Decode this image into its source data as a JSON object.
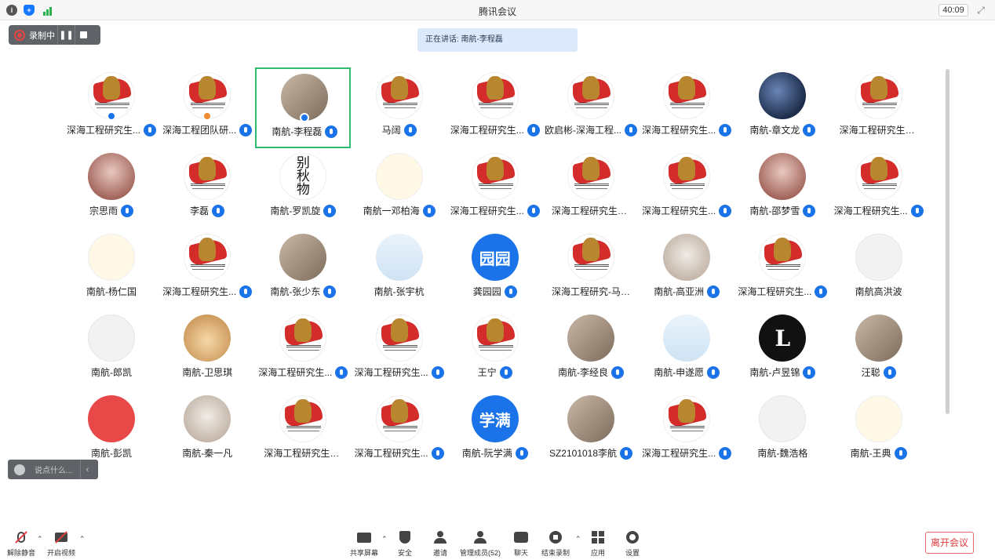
{
  "window": {
    "title": "腾讯会议",
    "timer": "40:09"
  },
  "recording": {
    "label": "录制中"
  },
  "speaking": {
    "text": "正在讲话: 南航-李程磊"
  },
  "participants": [
    {
      "name": "深海工程研究生...",
      "avatar": "logo",
      "badge": "blue"
    },
    {
      "name": "深海工程团队研...",
      "avatar": "logo",
      "badge": "orange"
    },
    {
      "name": "南航-李程磊",
      "avatar": "photo",
      "badge": "blue",
      "active": true
    },
    {
      "name": "马阔",
      "avatar": "logo"
    },
    {
      "name": "深海工程研究生...",
      "avatar": "logo"
    },
    {
      "name": "欧启彬-深海工程...",
      "avatar": "logo"
    },
    {
      "name": "深海工程研究生...",
      "avatar": "logo"
    },
    {
      "name": "南航-章文龙",
      "avatar": "dark"
    },
    {
      "name": "深海工程研究生党支...",
      "avatar": "logo",
      "no_mic": true
    },
    {
      "name": "宗思雨",
      "avatar": "rose"
    },
    {
      "name": "李磊",
      "avatar": "logo"
    },
    {
      "name": "南航-罗凯旋",
      "avatar": "calligraphy",
      "avatar_text": "别\n秋\n物"
    },
    {
      "name": "南航一邓柏海",
      "avatar": "cartoon"
    },
    {
      "name": "深海工程研究生...",
      "avatar": "logo"
    },
    {
      "name": "深海工程研究生党支...",
      "avatar": "logo",
      "no_mic": true
    },
    {
      "name": "深海工程研究生...",
      "avatar": "logo"
    },
    {
      "name": "南航-邵梦雪",
      "avatar": "rose"
    },
    {
      "name": "深海工程研究生...",
      "avatar": "logo"
    },
    {
      "name": "南航-杨仁国",
      "avatar": "cartoon",
      "no_mic": true
    },
    {
      "name": "深海工程研究生...",
      "avatar": "logo"
    },
    {
      "name": "南航-张少东",
      "avatar": "photo"
    },
    {
      "name": "南航-张宇杭",
      "avatar": "sky",
      "no_mic": true
    },
    {
      "name": "龚园园",
      "avatar": "text",
      "avatar_text": "园园"
    },
    {
      "name": "深海工程研究-马明雨",
      "avatar": "logo",
      "no_mic": true
    },
    {
      "name": "南航-高亚洲",
      "avatar": "cat"
    },
    {
      "name": "深海工程研究生...",
      "avatar": "logo"
    },
    {
      "name": "南航高洪波",
      "avatar": "white",
      "no_mic": true
    },
    {
      "name": "南航-郎凯",
      "avatar": "white",
      "no_mic": true
    },
    {
      "name": "南航-卫思琪",
      "avatar": "dog",
      "no_mic": true
    },
    {
      "name": "深海工程研究生...",
      "avatar": "logo"
    },
    {
      "name": "深海工程研究生...",
      "avatar": "logo"
    },
    {
      "name": "王宁",
      "avatar": "logo"
    },
    {
      "name": "南航-李经良",
      "avatar": "photo"
    },
    {
      "name": "南航-申遂愿",
      "avatar": "sky"
    },
    {
      "name": "南航-卢昱锦",
      "avatar": "black",
      "avatar_text": "L"
    },
    {
      "name": "汪聪",
      "avatar": "photo"
    },
    {
      "name": "南航-彭凯",
      "avatar": "red",
      "no_mic": true
    },
    {
      "name": "南航-秦一凡",
      "avatar": "cat",
      "no_mic": true
    },
    {
      "name": "深海工程研究生党支...",
      "avatar": "logo",
      "no_mic": true
    },
    {
      "name": "深海工程研究生...",
      "avatar": "logo"
    },
    {
      "name": "南航-阮学满",
      "avatar": "text",
      "avatar_text": "学满"
    },
    {
      "name": "SZ2101018李航",
      "avatar": "photo"
    },
    {
      "name": "深海工程研究生...",
      "avatar": "logo"
    },
    {
      "name": "南航-魏浩格",
      "avatar": "white",
      "no_mic": true
    },
    {
      "name": "南航-王典",
      "avatar": "cartoon"
    }
  ],
  "chat": {
    "placeholder": "说点什么..."
  },
  "toolbar": {
    "unmute": "解除静音",
    "start_video": "开启视频",
    "share_screen": "共享屏幕",
    "security": "安全",
    "invite": "邀请",
    "manage_members": "管理成员(52)",
    "chat": "聊天",
    "end_recording": "结束录制",
    "apps": "应用",
    "settings": "设置",
    "leave": "离开会议"
  },
  "colors": {
    "accent": "#1a73e8",
    "active_border": "#2bbd6e",
    "leave": "#e23c3c"
  }
}
